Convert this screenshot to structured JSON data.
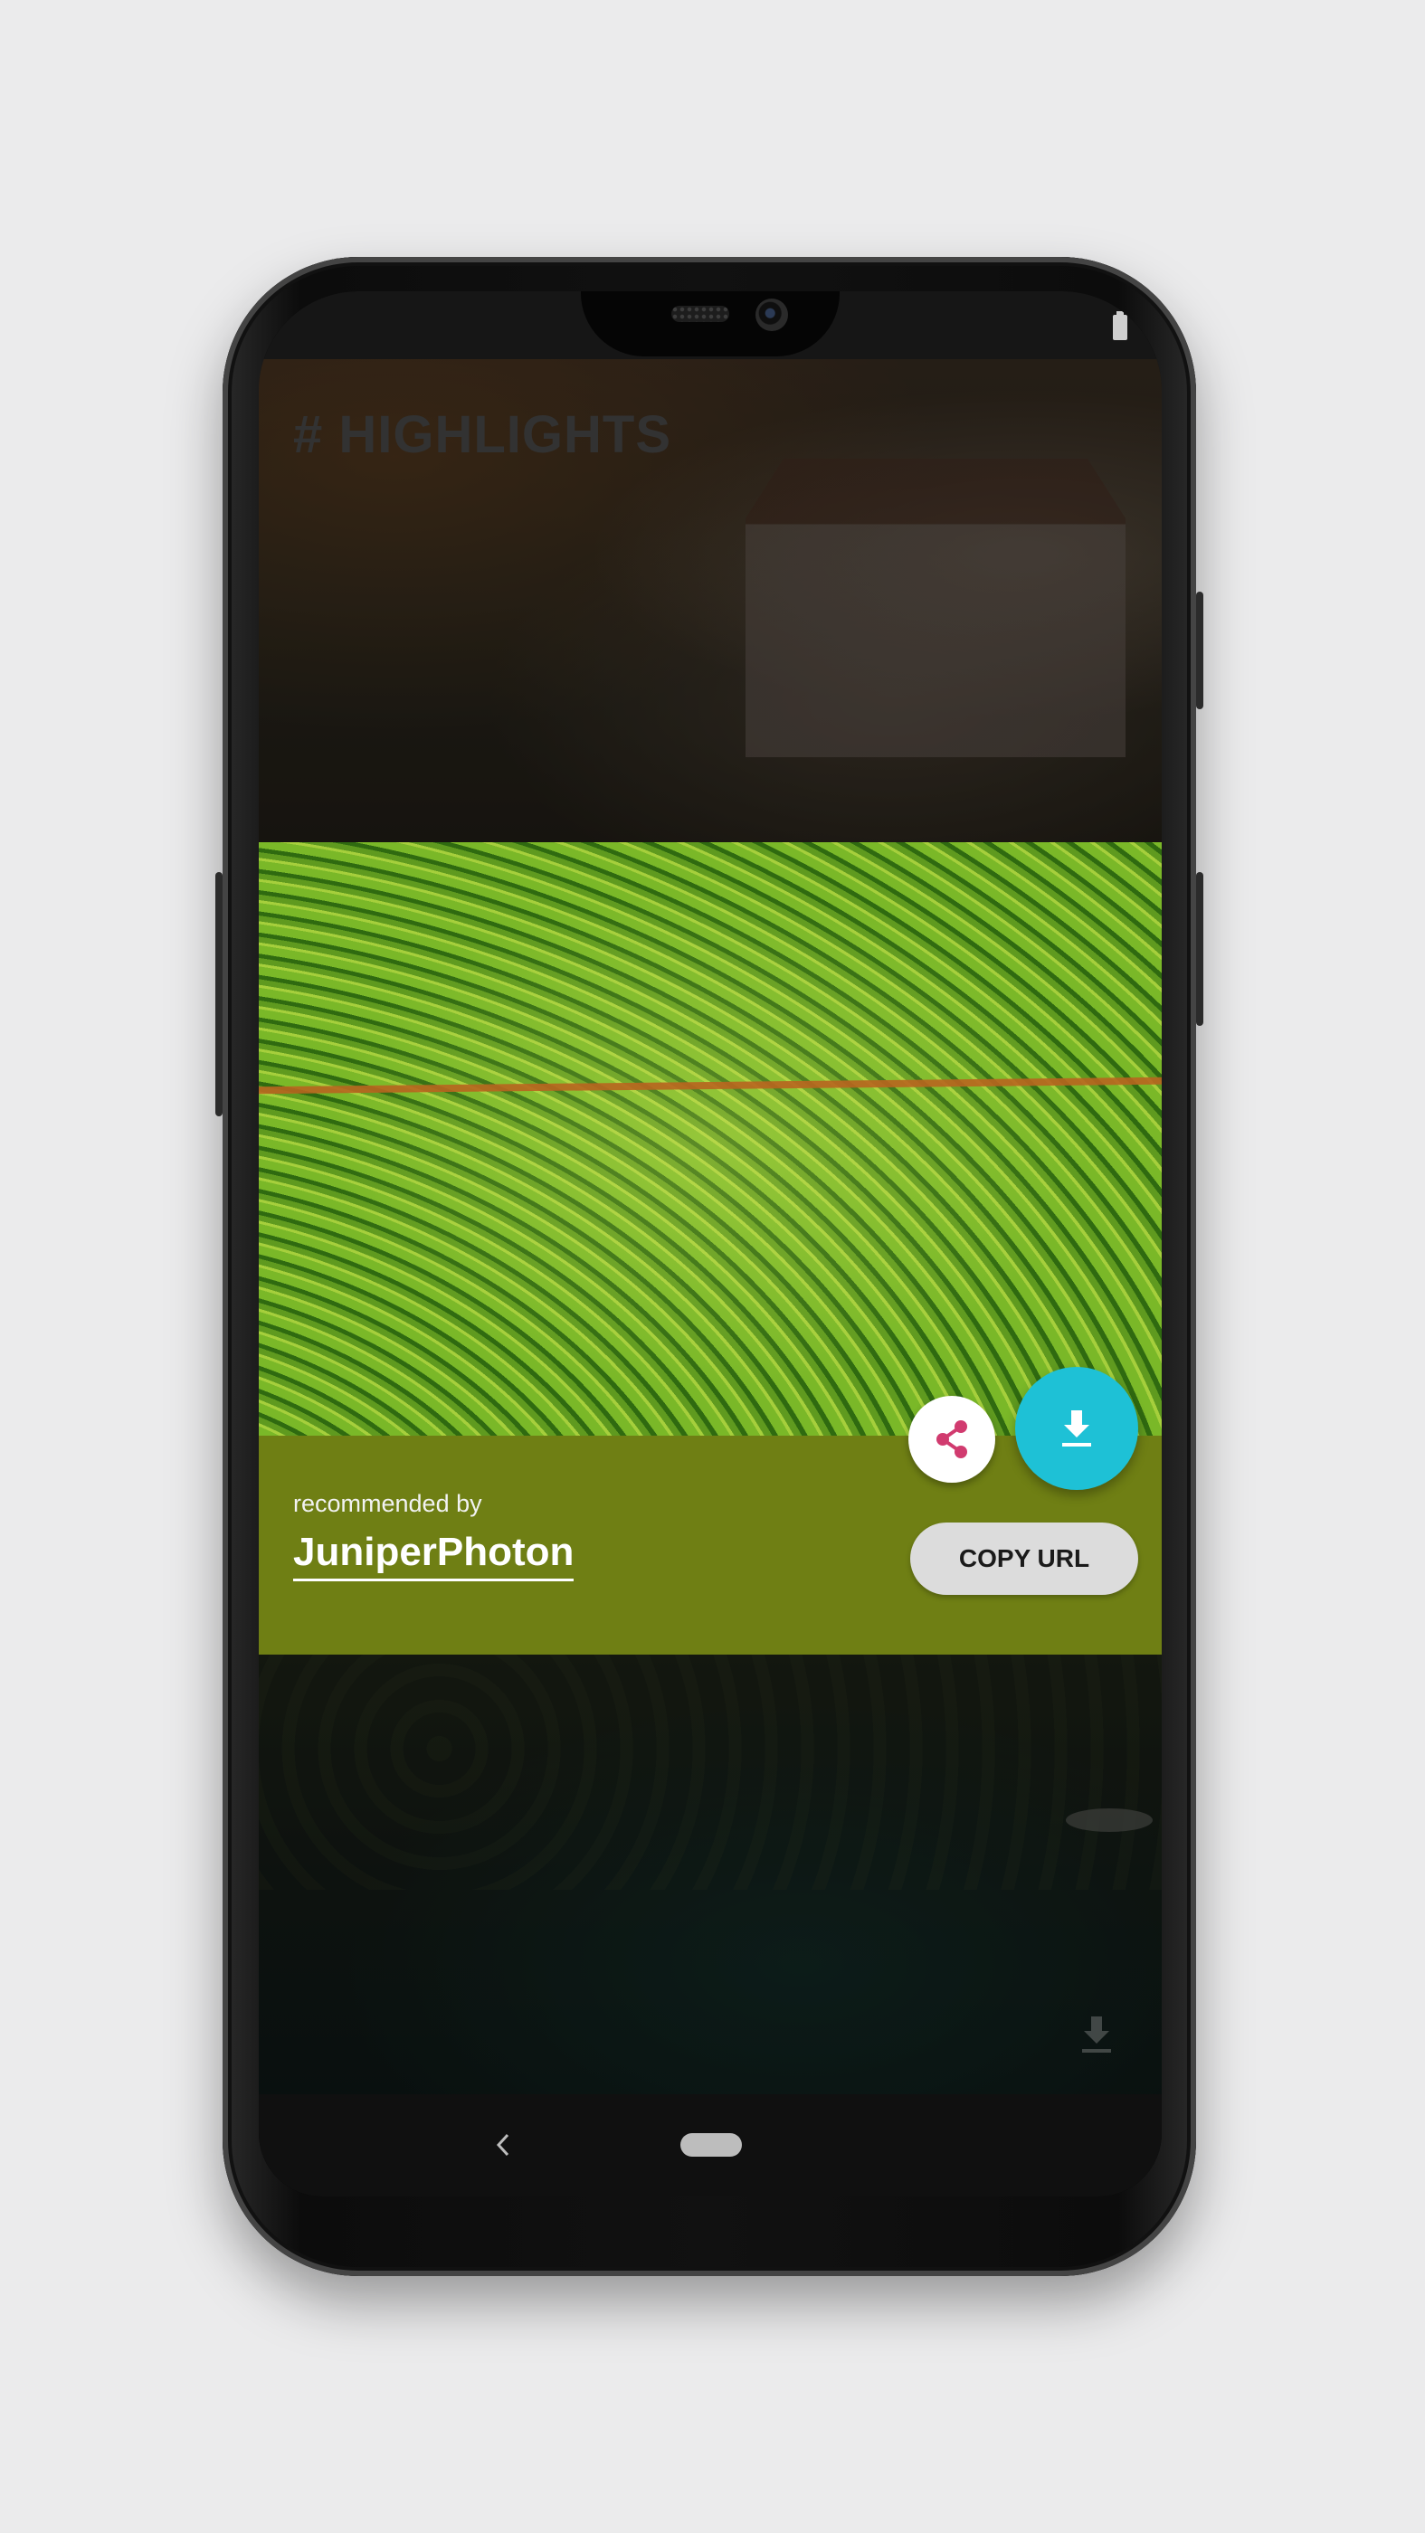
{
  "highlights": {
    "title": "# HIGHLIGHTS"
  },
  "photo_dialog": {
    "recommended_label": "recommended by",
    "author": "JuniperPhoton",
    "copy_url_label": "COPY URL",
    "share_icon": "share-icon",
    "download_icon": "download-icon",
    "panel_color": "#6f7f14",
    "fab_color": "#1ec1d6",
    "share_icon_color": "#d13b6f"
  },
  "nav": {
    "back_icon": "back-icon",
    "home_icon": "home-pill-icon"
  }
}
